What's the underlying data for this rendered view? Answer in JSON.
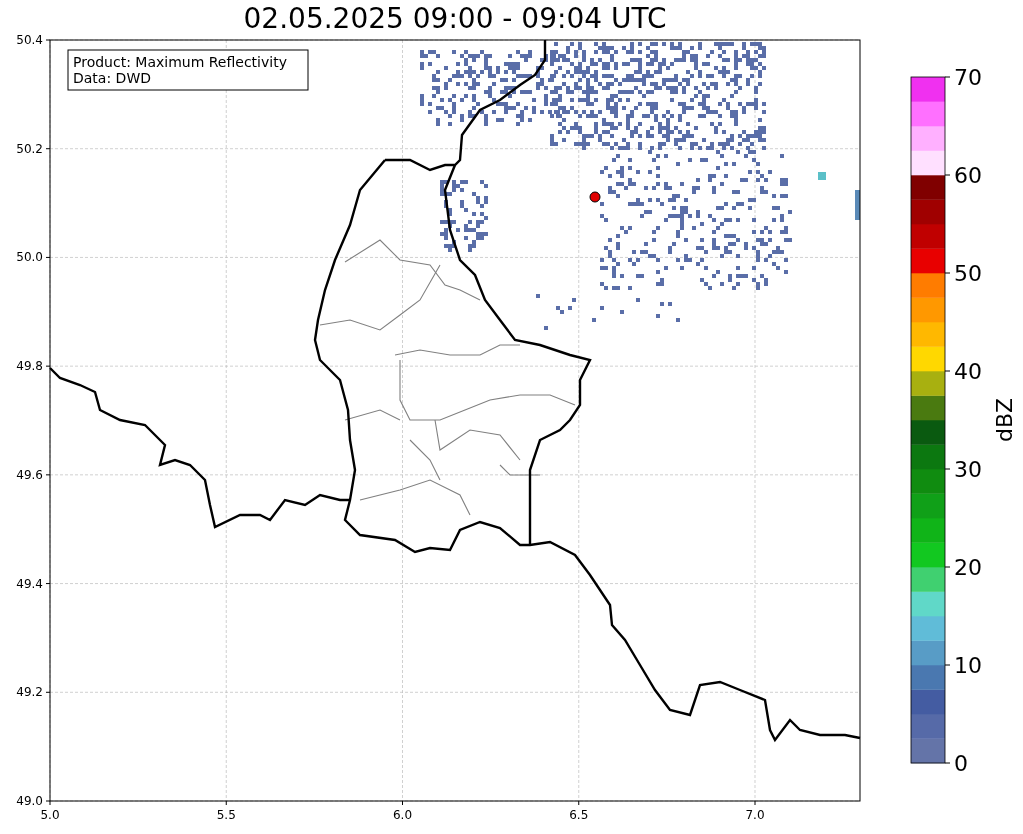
{
  "title": "02.05.2025 09:00 - 09:04 UTC",
  "info_box": [
    "Product: Maximum Reflectivity",
    "Data: DWD"
  ],
  "map": {
    "x_ticks": [
      "5.0",
      "5.5",
      "6.0",
      "6.5",
      "7.0"
    ],
    "y_ticks": [
      "50.4",
      "50.2",
      "50.0",
      "49.8",
      "49.6",
      "49.4",
      "49.2",
      "49.0"
    ]
  },
  "colorbar": {
    "label": "dBZ",
    "ticks": [
      "70",
      "60",
      "50",
      "40",
      "30",
      "20",
      "10",
      "0"
    ],
    "segments": [
      {
        "color": "#6474a8"
      },
      {
        "color": "#566aa8"
      },
      {
        "color": "#445ca2"
      },
      {
        "color": "#4a78b0"
      },
      {
        "color": "#589cc6"
      },
      {
        "color": "#60bcd8"
      },
      {
        "color": "#60d8c8"
      },
      {
        "color": "#40d070"
      },
      {
        "color": "#12c820"
      },
      {
        "color": "#10b418"
      },
      {
        "color": "#10a018"
      },
      {
        "color": "#108c10"
      },
      {
        "color": "#0c7810"
      },
      {
        "color": "#0a5a10"
      },
      {
        "color": "#4a7a10"
      },
      {
        "color": "#a8b010"
      },
      {
        "color": "#ffd800"
      },
      {
        "color": "#ffb800"
      },
      {
        "color": "#ff9800"
      },
      {
        "color": "#ff7c00"
      },
      {
        "color": "#e80000"
      },
      {
        "color": "#c00000"
      },
      {
        "color": "#a00000"
      },
      {
        "color": "#800000"
      },
      {
        "color": "#ffe0ff"
      },
      {
        "color": "#ffb0ff"
      },
      {
        "color": "#ff70ff"
      },
      {
        "color": "#f030f0"
      }
    ]
  }
}
